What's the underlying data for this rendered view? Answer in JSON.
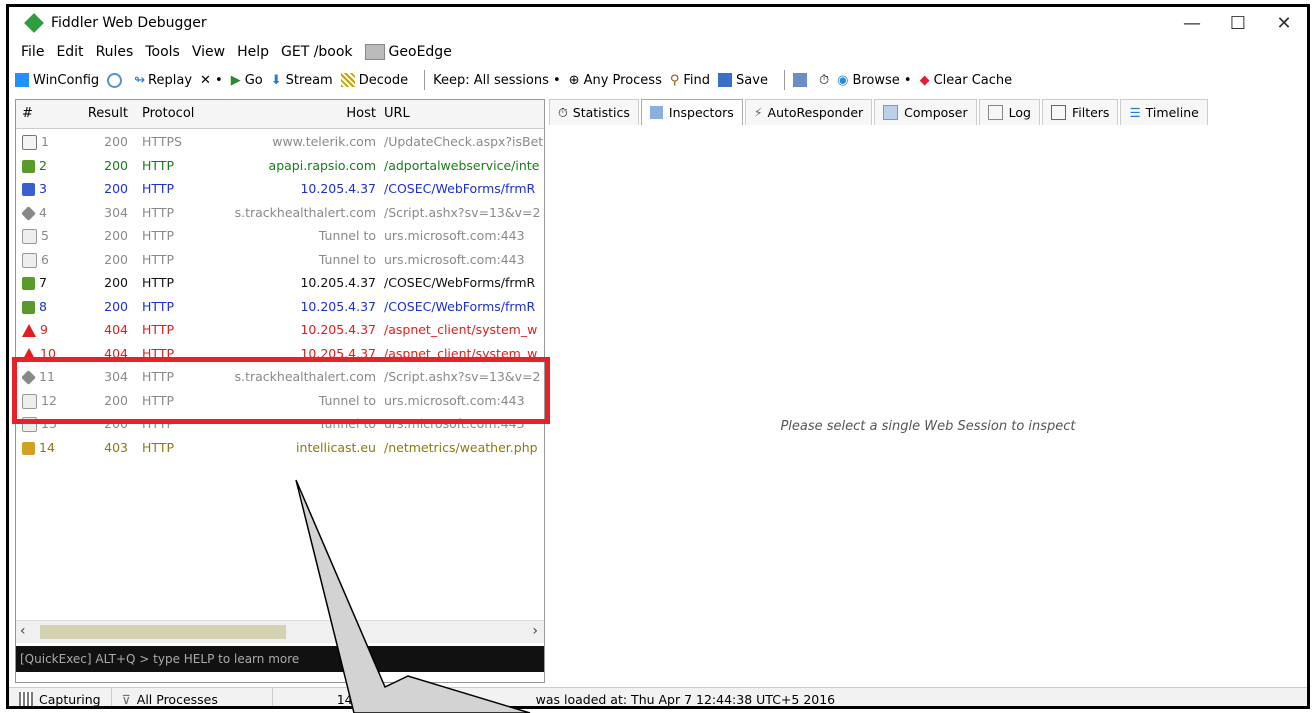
{
  "window": {
    "title": "Fiddler Web Debugger",
    "controls": {
      "minimize": "—",
      "maximize": "☐",
      "close": "✕"
    }
  },
  "menu": [
    "File",
    "Edit",
    "Rules",
    "Tools",
    "View",
    "Help",
    "GET /book",
    "GeoEdge"
  ],
  "toolbar": {
    "winconfig": "WinConfig",
    "replay": "Replay",
    "remove": "✕ •",
    "go": "Go",
    "stream": "Stream",
    "decode": "Decode",
    "keep": "Keep: All sessions •",
    "any_process": "Any Process",
    "find": "Find",
    "save": "Save",
    "browse": "Browse •",
    "clear_cache": "Clear Cache"
  },
  "sessions": {
    "columns": [
      "#",
      "Result",
      "Protocol",
      "Host",
      "URL"
    ],
    "rows": [
      {
        "num": "1",
        "result": "200",
        "protocol": "HTTPS",
        "host": "www.telerik.com",
        "url": "/UpdateCheck.aspx?isBet",
        "color": "gray",
        "icon": "document-icon"
      },
      {
        "num": "2",
        "result": "200",
        "protocol": "HTTP",
        "host": "apapi.rapsio.com",
        "url": "/adportalwebservice/inte",
        "color": "green",
        "icon": "arrow-right-icon"
      },
      {
        "num": "3",
        "result": "200",
        "protocol": "HTTP",
        "host": "10.205.4.37",
        "url": "/COSEC/WebForms/frmR",
        "color": "blue",
        "icon": "code-icon"
      },
      {
        "num": "4",
        "result": "304",
        "protocol": "HTTP",
        "host": "s.trackhealthalert.com",
        "url": "/Script.ashx?sv=13&v=2",
        "color": "gray",
        "icon": "diamond-icon"
      },
      {
        "num": "5",
        "result": "200",
        "protocol": "HTTP",
        "host": "Tunnel to",
        "url": "urs.microsoft.com:443",
        "color": "gray",
        "icon": "lock-icon"
      },
      {
        "num": "6",
        "result": "200",
        "protocol": "HTTP",
        "host": "Tunnel to",
        "url": "urs.microsoft.com:443",
        "color": "gray",
        "icon": "lock-icon"
      },
      {
        "num": "7",
        "result": "200",
        "protocol": "HTTP",
        "host": "10.205.4.37",
        "url": "/COSEC/WebForms/frmR",
        "color": "black",
        "icon": "arrow-right-icon"
      },
      {
        "num": "8",
        "result": "200",
        "protocol": "HTTP",
        "host": "10.205.4.37",
        "url": "/COSEC/WebForms/frmR",
        "color": "blue",
        "icon": "arrow-right-icon"
      },
      {
        "num": "9",
        "result": "404",
        "protocol": "HTTP",
        "host": "10.205.4.37",
        "url": "/aspnet_client/system_w",
        "color": "red",
        "icon": "warning-icon"
      },
      {
        "num": "10",
        "result": "404",
        "protocol": "HTTP",
        "host": "10.205.4.37",
        "url": "/aspnet_client/system_w",
        "color": "red",
        "icon": "warning-icon"
      },
      {
        "num": "11",
        "result": "304",
        "protocol": "HTTP",
        "host": "s.trackhealthalert.com",
        "url": "/Script.ashx?sv=13&v=2",
        "color": "gray",
        "icon": "diamond-icon"
      },
      {
        "num": "12",
        "result": "200",
        "protocol": "HTTP",
        "host": "Tunnel to",
        "url": "urs.microsoft.com:443",
        "color": "gray",
        "icon": "lock-icon"
      },
      {
        "num": "13",
        "result": "200",
        "protocol": "HTTP",
        "host": "Tunnel to",
        "url": "urs.microsoft.com:443",
        "color": "gray",
        "icon": "lock-icon"
      },
      {
        "num": "14",
        "result": "403",
        "protocol": "HTTP",
        "host": "intellicast.eu",
        "url": "/netmetrics/weather.php",
        "color": "olive",
        "icon": "key-icon"
      }
    ]
  },
  "quickexec": "[QuickExec] ALT+Q > type HELP to learn more",
  "tabs": [
    "Statistics",
    "Inspectors",
    "AutoResponder",
    "Composer",
    "Log",
    "Filters",
    "Timeline"
  ],
  "inspector_message": "Please select a single Web Session to inspect",
  "status": {
    "capturing": "Capturing",
    "processes": "All Processes",
    "count": "14",
    "message": "was loaded at: Thu Apr 7 12:44:38 UTC+5 2016"
  },
  "colors": {
    "gray": "#8a8a8a",
    "green": "#1b7a1b",
    "blue": "#1c2fd6",
    "black": "#111111",
    "red": "#e01e1e",
    "olive": "#8a7a10",
    "highlight": "#e8202a"
  }
}
